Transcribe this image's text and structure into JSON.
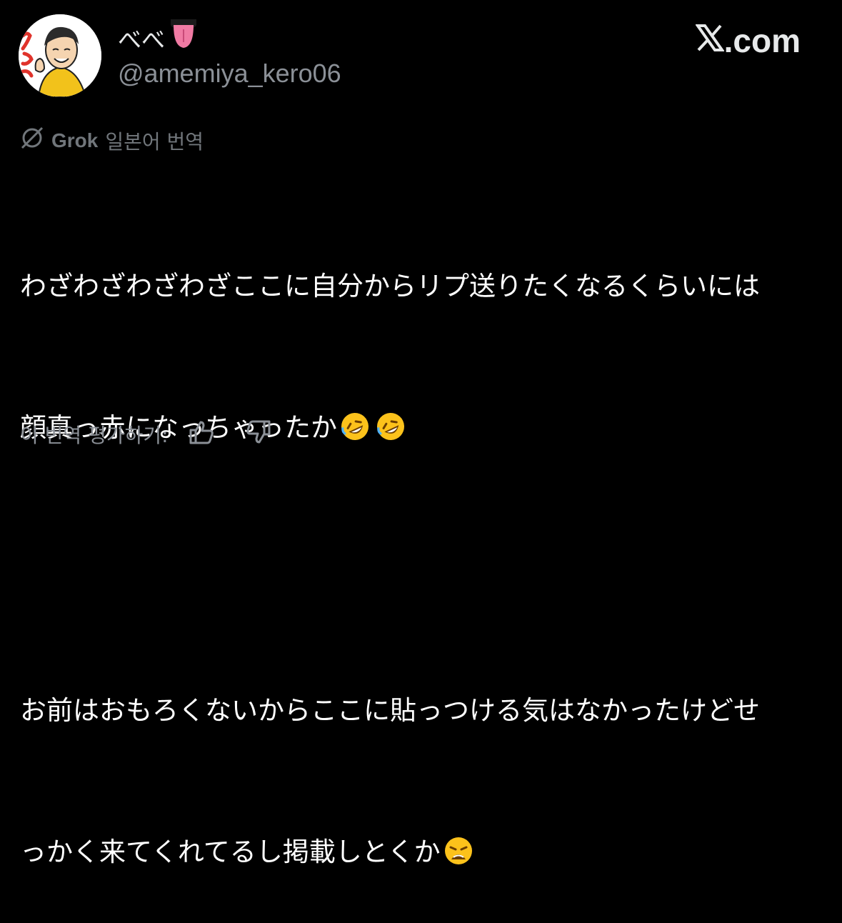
{
  "header": {
    "display_name": "べべ",
    "display_name_emoji": "tongue-emoji",
    "handle": "@amemiya_kero06",
    "site_logo": "X",
    "site_suffix": ".com"
  },
  "translation": {
    "icon": "grok-icon",
    "provider": "Grok",
    "label": "일본어 번역"
  },
  "tweet": {
    "line1": "わざわざわざわざここに自分からリプ送りたくなるくらいには",
    "line2": "顔真っ赤になっちゃったか",
    "line2_emojis": [
      "rofl-emoji",
      "rofl-emoji"
    ],
    "line3": "お前はおもろくないからここに貼っつける気はなかったけどせ",
    "line4": "っかく来てくれてるし掲載しとくか",
    "line4_emoji": "weary-emoji"
  },
  "rating": {
    "label": "이 번역 평가하기:",
    "thumbs_up": "thumbs-up-icon",
    "thumbs_down": "thumbs-down-icon"
  },
  "colors": {
    "background": "#000000",
    "text": "#ffffff",
    "muted": "#71767b",
    "avatar_yellow": "#f2c21b"
  }
}
